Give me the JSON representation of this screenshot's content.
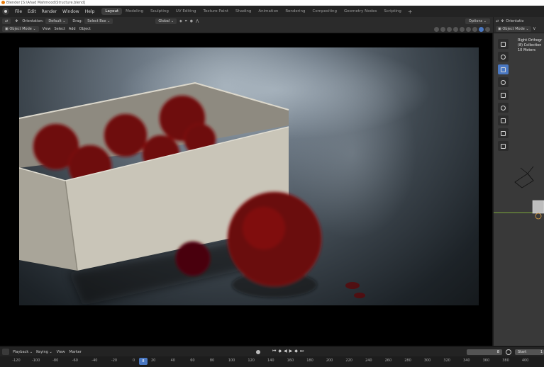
{
  "window": {
    "title": "Blender [S:\\Ahad Mahmood\\Structure.blend]"
  },
  "menu": [
    "File",
    "Edit",
    "Render",
    "Window",
    "Help"
  ],
  "workspaces": [
    {
      "label": "Layout",
      "active": true
    },
    {
      "label": "Modeling"
    },
    {
      "label": "Sculpting"
    },
    {
      "label": "UV Editing"
    },
    {
      "label": "Texture Paint"
    },
    {
      "label": "Shading"
    },
    {
      "label": "Animation"
    },
    {
      "label": "Rendering"
    },
    {
      "label": "Compositing"
    },
    {
      "label": "Geometry Nodes"
    },
    {
      "label": "Scripting"
    }
  ],
  "toolbar": {
    "orientation_label": "Orientation:",
    "orientation_value": "Default",
    "drag_label": "Drag:",
    "drag_value": "Select Box",
    "transform_value": "Global",
    "options_label": "Options"
  },
  "header": {
    "mode": "Object Mode",
    "menus": [
      "View",
      "Select",
      "Add",
      "Object"
    ]
  },
  "right_panel": {
    "orientation_label": "Orientatio",
    "mode": "Object Mode",
    "view_menu": "V",
    "info": [
      "Right Orthogr",
      "(8) Collection",
      "10 Meters"
    ]
  },
  "timeline": {
    "menus": [
      "Playback",
      "Keying",
      "View",
      "Marker"
    ],
    "current_frame": "8",
    "start_label": "Start",
    "start_value": "1",
    "ticks": [
      "-120",
      "-100",
      "-80",
      "-60",
      "-40",
      "-20",
      "0",
      "20",
      "40",
      "60",
      "80",
      "100",
      "120",
      "140",
      "160",
      "180",
      "200",
      "220",
      "240",
      "260",
      "280",
      "300",
      "320",
      "340",
      "360",
      "380",
      "400"
    ],
    "playhead_label": "8"
  },
  "colors": {
    "accent": "#4a78c2",
    "flower": "#7a0c10",
    "box": "#c9c5b8"
  }
}
